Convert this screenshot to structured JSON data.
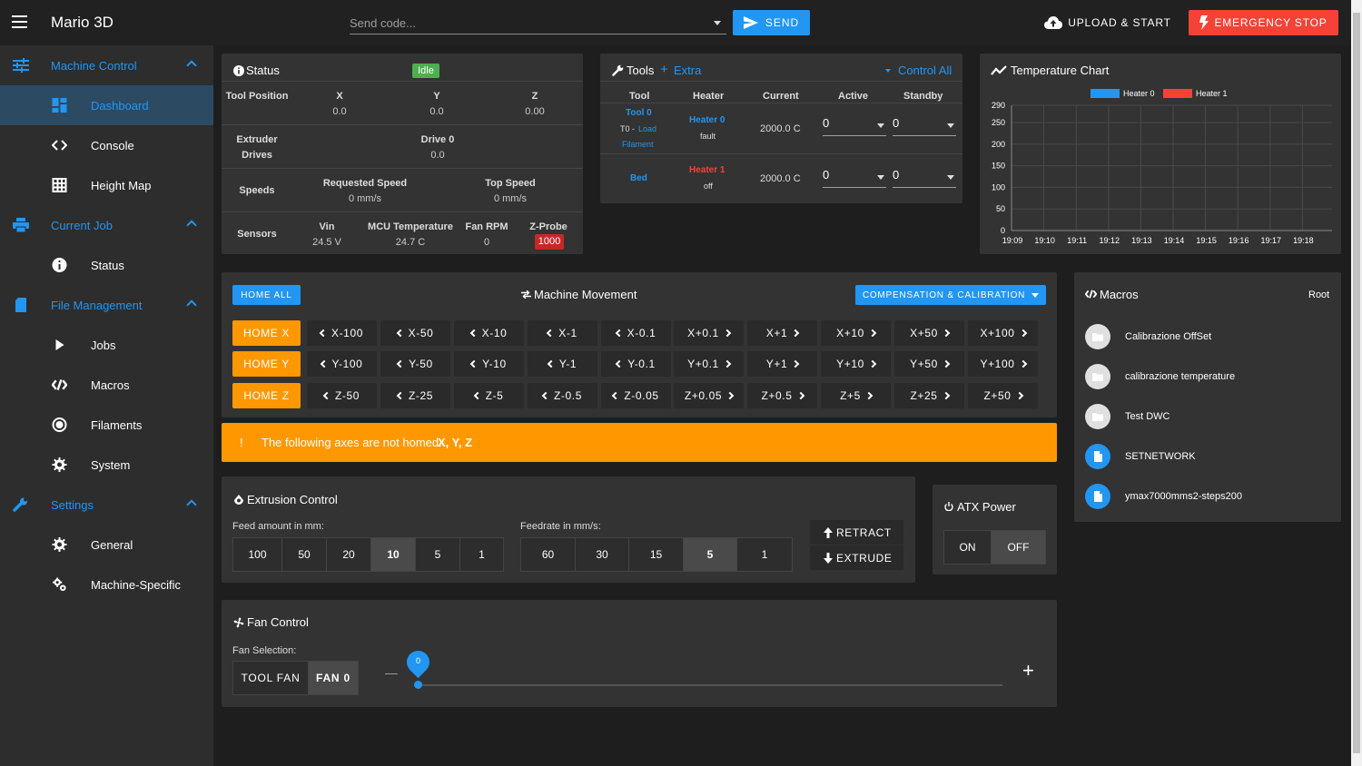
{
  "app": {
    "title": "Mario 3D"
  },
  "toolbar": {
    "send_placeholder": "Send code...",
    "send_label": "SEND",
    "upload_label": "UPLOAD & START",
    "estop_label": "EMERGENCY STOP"
  },
  "sidebar": {
    "groups": [
      {
        "label": "Machine Control",
        "items": [
          "Dashboard",
          "Console",
          "Height Map"
        ]
      },
      {
        "label": "Current Job",
        "items": [
          "Status"
        ]
      },
      {
        "label": "File Management",
        "items": [
          "Jobs",
          "Macros",
          "Filaments",
          "System"
        ]
      },
      {
        "label": "Settings",
        "items": [
          "General",
          "Machine-Specific"
        ]
      }
    ]
  },
  "status": {
    "title": "Status",
    "state": "Idle",
    "tool_position_label": "Tool Position",
    "axes": [
      {
        "name": "X",
        "value": "0.0"
      },
      {
        "name": "Y",
        "value": "0.0"
      },
      {
        "name": "Z",
        "value": "0.00"
      }
    ],
    "extruder_label": "Extruder Drives",
    "drive_name": "Drive 0",
    "drive_value": "0.0",
    "speeds_label": "Speeds",
    "requested_speed_label": "Requested Speed",
    "requested_speed": "0 mm/s",
    "top_speed_label": "Top Speed",
    "top_speed": "0 mm/s",
    "sensors_label": "Sensors",
    "vin_label": "Vin",
    "vin": "24.5 V",
    "mcu_label": "MCU Temperature",
    "mcu": "24.7 C",
    "fan_rpm_label": "Fan RPM",
    "fan_rpm": "0",
    "zprobe_label": "Z-Probe",
    "zprobe": "1000"
  },
  "tools": {
    "title": "Tools",
    "extra_label": "Extra",
    "control_all": "Control All",
    "headers": [
      "Tool",
      "Heater",
      "Current",
      "Active",
      "Standby"
    ],
    "tool0_name": "Tool 0",
    "tool0_sub_prefix": "T0 - ",
    "tool0_load": "Load",
    "tool0_filament": "Filament",
    "heater0": "Heater 0",
    "heater0_state": "fault",
    "heater0_current": "2000.0 C",
    "heater0_active": "0",
    "heater0_standby": "0",
    "bed_name": "Bed",
    "heater1": "Heater 1",
    "heater1_state": "off",
    "heater1_current": "2000.0 C",
    "heater1_active": "0",
    "heater1_standby": "0"
  },
  "temperature_chart": {
    "title": "Temperature Chart",
    "series": [
      {
        "name": "Heater 0",
        "color": "#2196f3"
      },
      {
        "name": "Heater 1",
        "color": "#f44336"
      }
    ],
    "y_ticks": [
      "290",
      "250",
      "200",
      "150",
      "100",
      "50",
      "0"
    ],
    "x_ticks": [
      "19:09",
      "19:10",
      "19:11",
      "19:12",
      "19:13",
      "19:14",
      "19:15",
      "19:16",
      "19:17",
      "19:18"
    ]
  },
  "movement": {
    "home_all": "HOME ALL",
    "title": "Machine Movement",
    "compensation": "COMPENSATION & CALIBRATION",
    "rows": [
      {
        "home": "HOME X",
        "buttons": [
          "X-100",
          "X-50",
          "X-10",
          "X-1",
          "X-0.1",
          "X+0.1",
          "X+1",
          "X+10",
          "X+50",
          "X+100"
        ]
      },
      {
        "home": "HOME Y",
        "buttons": [
          "Y-100",
          "Y-50",
          "Y-10",
          "Y-1",
          "Y-0.1",
          "Y+0.1",
          "Y+1",
          "Y+10",
          "Y+50",
          "Y+100"
        ]
      },
      {
        "home": "HOME Z",
        "buttons": [
          "Z-50",
          "Z-25",
          "Z-5",
          "Z-0.5",
          "Z-0.05",
          "Z+0.05",
          "Z+0.5",
          "Z+5",
          "Z+25",
          "Z+50"
        ]
      }
    ]
  },
  "warning": {
    "icon": "!",
    "text": "The following axes are not homed:",
    "axes": "X, Y, Z"
  },
  "extrusion": {
    "title": "Extrusion Control",
    "feed_label": "Feed amount in mm:",
    "feed_options": [
      "100",
      "50",
      "20",
      "10",
      "5",
      "1"
    ],
    "feed_selected": "10",
    "feedrate_label": "Feedrate in mm/s:",
    "feedrate_options": [
      "60",
      "30",
      "15",
      "5",
      "1"
    ],
    "feedrate_selected": "5",
    "retract": "RETRACT",
    "extrude": "EXTRUDE"
  },
  "atx": {
    "title": "ATX Power",
    "on": "ON",
    "off": "OFF"
  },
  "fan": {
    "title": "Fan Control",
    "selection_label": "Fan Selection:",
    "options": [
      "TOOL FAN",
      "FAN 0"
    ],
    "selected": "FAN 0",
    "value": "0",
    "minus": "—",
    "plus": "+"
  },
  "macros": {
    "title": "Macros",
    "root": "Root",
    "items": [
      {
        "name": "Calibrazione OffSet",
        "type": "folder"
      },
      {
        "name": "calibrazione temperature",
        "type": "folder"
      },
      {
        "name": "Test DWC",
        "type": "folder"
      },
      {
        "name": "SETNETWORK",
        "type": "file"
      },
      {
        "name": "ymax7000mms2-steps200",
        "type": "file"
      }
    ]
  },
  "colors": {
    "accent": "#2196f3",
    "warning": "#ff9800",
    "danger": "#f44336",
    "success": "#4caf50"
  }
}
